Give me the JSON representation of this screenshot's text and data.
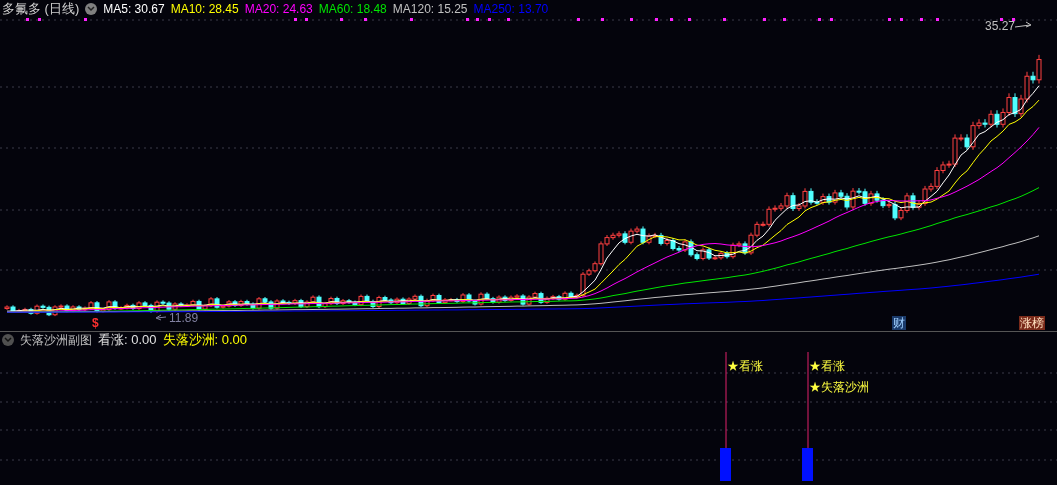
{
  "main_panel": {
    "title": "多氟多 (日线)",
    "moving_averages": [
      {
        "label": "MA5: 30.67",
        "color": "#ffffff"
      },
      {
        "label": "MA10: 28.45",
        "color": "#ffff00"
      },
      {
        "label": "MA20: 24.63",
        "color": "#ff00ff"
      },
      {
        "label": "MA60: 18.48",
        "color": "#00e600"
      },
      {
        "label": "MA120: 15.25",
        "color": "#c0c0c0"
      },
      {
        "label": "MA250: 13.70",
        "color": "#0000ff"
      }
    ],
    "high_label": "35.27",
    "low_label": "11.89",
    "markers": [
      {
        "kind": "dollar",
        "text": "$"
      },
      {
        "kind": "finance",
        "text": "财"
      },
      {
        "kind": "limit",
        "text": "涨榜"
      }
    ]
  },
  "sub_panel": {
    "title": "失落沙洲副图",
    "indicators": [
      {
        "label": "看涨: 0.00",
        "color": "#e0e0e0"
      },
      {
        "label": "失落沙洲: 0.00",
        "color": "#ffff00"
      }
    ],
    "signals": [
      {
        "labels": [
          "★看涨"
        ]
      },
      {
        "labels": [
          "★看涨",
          "★失落沙洲"
        ]
      }
    ]
  }
}
